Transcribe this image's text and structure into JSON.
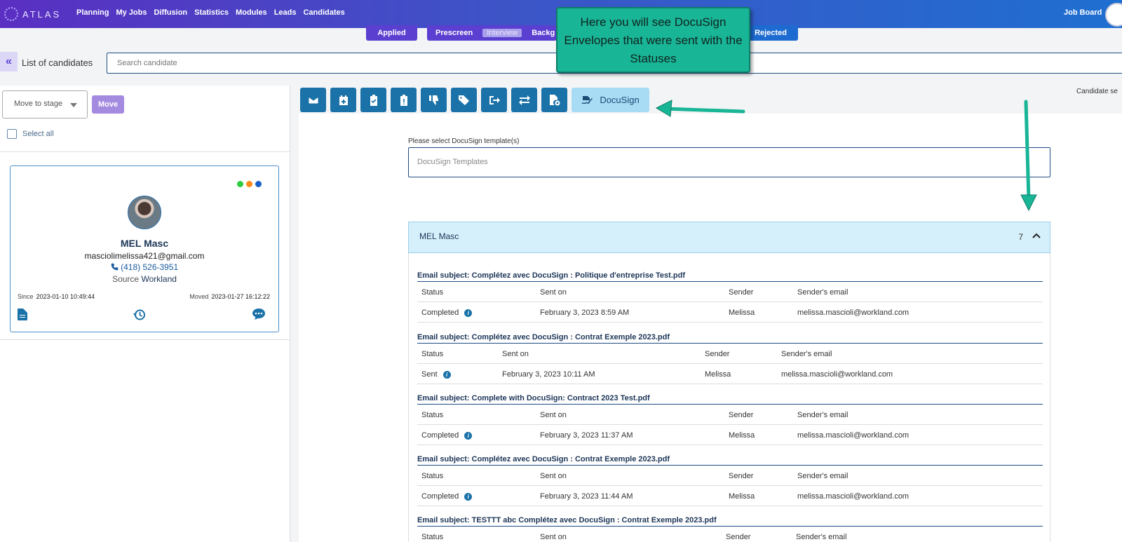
{
  "app": {
    "logo_text": "ATLAS",
    "nav": [
      "Planning",
      "My Jobs",
      "Diffusion",
      "Statistics",
      "Modules",
      "Leads",
      "Candidates"
    ],
    "job_board": "Job Board"
  },
  "stages": {
    "applied": "Applied",
    "prescreen": "Prescreen",
    "interview": "Interview",
    "background": "Backg",
    "rejected": "Rejected"
  },
  "list": {
    "title": "List of candidates",
    "search_placeholder": "Search candidate"
  },
  "left": {
    "move_to_stage": "Move to stage",
    "move_button": "Move",
    "select_all": "Select all"
  },
  "candidate": {
    "name": "MEL Masc",
    "email": "masciolimelissa421@gmail.com",
    "phone": "(418) 526-3951",
    "source_label": "Source",
    "source_value": "Workland",
    "since_label": "Since",
    "since_value": "2023-01-10 10:49:44",
    "moved_label": "Moved",
    "moved_value": "2023-01-27 16:12:22",
    "status_dots": [
      "#2ecc40",
      "#ff8c1a",
      "#1a5fc8"
    ]
  },
  "toolbar": {
    "docusign_label": "DocuSign",
    "icons": [
      "email-icon",
      "calendar-add-icon",
      "clipboard-check-icon",
      "clipboard-icon",
      "thumbs-down-icon",
      "tags-icon",
      "sign-out-icon",
      "transfer-icon",
      "file-settings-icon"
    ],
    "candidate_search_cut": "Candidate se"
  },
  "docusign": {
    "template_label": "Please select DocuSign template(s)",
    "template_placeholder": "DocuSign Templates",
    "accordion_title": "MEL Masc",
    "accordion_count": "7",
    "columns": [
      "Status",
      "Sent on",
      "Sender",
      "Sender's email"
    ],
    "envelopes": [
      {
        "subject": "Email subject: Complétez avec DocuSign : Politique d'entreprise Test.pdf",
        "status": "Completed",
        "sent_on": "February 3, 2023 8:59 AM",
        "sender": "Melissa",
        "email": "melissa.mascioli@workland.com"
      },
      {
        "subject": "Email subject: Complétez avec DocuSign : Contrat Exemple 2023.pdf",
        "status": "Sent",
        "sent_on": "February 3, 2023 10:11 AM",
        "sender": "Melissa",
        "email": "melissa.mascioli@workland.com"
      },
      {
        "subject": "Email subject: Complete with DocuSign: Contract 2023 Test.pdf",
        "status": "Completed",
        "sent_on": "February 3, 2023 11:37 AM",
        "sender": "Melissa",
        "email": "melissa.mascioli@workland.com"
      },
      {
        "subject": "Email subject: Complétez avec DocuSign : Contrat Exemple 2023.pdf",
        "status": "Completed",
        "sent_on": "February 3, 2023 11:44 AM",
        "sender": "Melissa",
        "email": "melissa.mascioli@workland.com"
      },
      {
        "subject": "Email subject: TESTTT abc Complétez avec DocuSign : Contrat Exemple 2023.pdf",
        "status": "",
        "sent_on": "",
        "sender": "",
        "email": ""
      }
    ]
  },
  "callout": {
    "text": "Here you will see DocuSign Envelopes that were sent with the Statuses"
  },
  "colors": {
    "brand_gradient_start": "#5a2fc2",
    "brand_gradient_end": "#1f6fd0",
    "toolbar_button": "#1a72a8",
    "callout": "#19b597",
    "arrow": "#19b597"
  }
}
